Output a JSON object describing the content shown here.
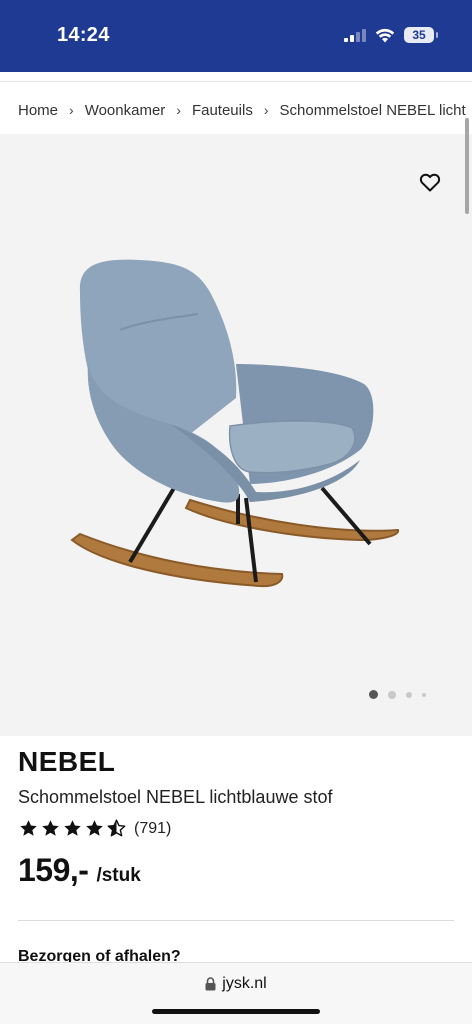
{
  "status_bar": {
    "time": "14:24",
    "battery_level": "35",
    "background_color": "#1f3a93"
  },
  "breadcrumb": {
    "items": [
      "Home",
      "Woonkamer",
      "Fauteuils",
      "Schommelstoel NEBEL licht"
    ],
    "separator": "›"
  },
  "gallery": {
    "image_alt": "rocking-chair-image",
    "dots_total": 4,
    "active_dot": 0
  },
  "product": {
    "brand": "NEBEL",
    "name": "Schommelstoel NEBEL lichtblauwe stof",
    "rating_value": 4.5,
    "rating_max": 5,
    "review_count": "(791)",
    "price": "159,-",
    "price_unit": "/stuk"
  },
  "delivery": {
    "heading": "Bezorgen of afhalen?"
  },
  "browser": {
    "url": "jysk.nl"
  }
}
